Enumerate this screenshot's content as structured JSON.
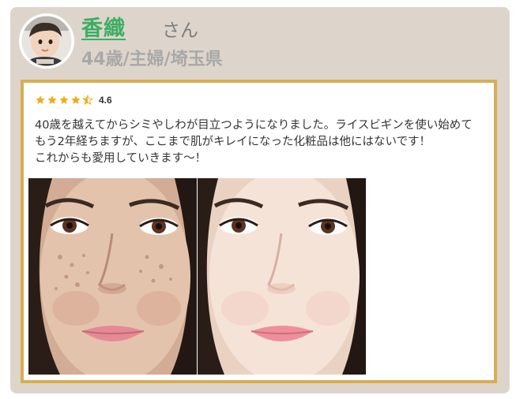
{
  "reviewer": {
    "name": "香織",
    "honorific": "さん",
    "meta": "44歳/主婦/埼玉県"
  },
  "review": {
    "rating": 4.6,
    "rating_label": "4.6",
    "lines": [
      "40歳を越えてからシミやしわが目立つようになりました。ライスビギンを使い始めて",
      "もう2年経ちますが、ここまで肌がキレイになった化粧品は他にはないです！",
      "これからも愛用していきます〜！"
    ]
  },
  "colors": {
    "card_background": "#ddd5cb",
    "review_border": "#d8ae52",
    "name": "#3cae62",
    "star": "#f0ad1a"
  },
  "icons": {
    "star": "star-icon",
    "half_star": "star-half-icon"
  }
}
